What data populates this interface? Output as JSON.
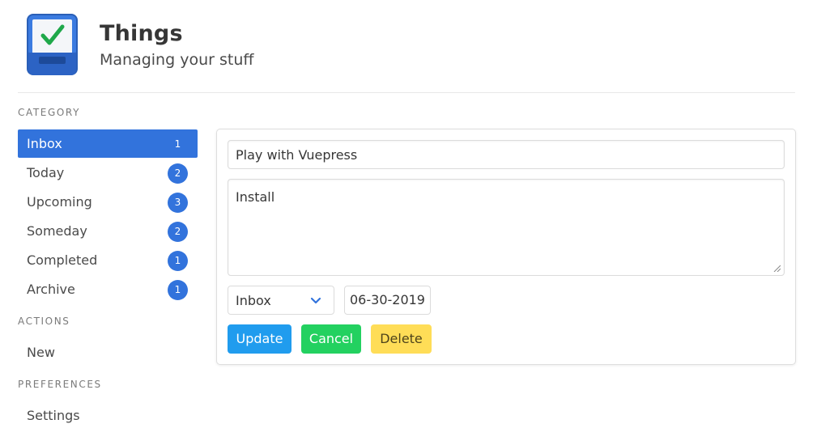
{
  "app": {
    "title": "Things",
    "subtitle": "Managing your stuff",
    "logo_icon": "checkbox-tray-icon"
  },
  "sidebar": {
    "category_label": "CATEGORY",
    "categories": [
      {
        "label": "Inbox",
        "count": "1",
        "active": true
      },
      {
        "label": "Today",
        "count": "2"
      },
      {
        "label": "Upcoming",
        "count": "3"
      },
      {
        "label": "Someday",
        "count": "2"
      },
      {
        "label": "Completed",
        "count": "1"
      },
      {
        "label": "Archive",
        "count": "1"
      }
    ],
    "actions_label": "ACTIONS",
    "actions": [
      {
        "label": "New"
      }
    ],
    "preferences_label": "PREFERENCES",
    "preferences": [
      {
        "label": "Settings"
      }
    ]
  },
  "editor": {
    "title_value": "Play with Vuepress",
    "notes_value": "Install",
    "category_select": "Inbox",
    "date_value": "06-30-2019",
    "update_label": "Update",
    "cancel_label": "Cancel",
    "delete_label": "Delete"
  },
  "colors": {
    "accent": "#3273dc",
    "update": "#209cee",
    "cancel": "#23d160",
    "delete": "#ffdd57"
  }
}
